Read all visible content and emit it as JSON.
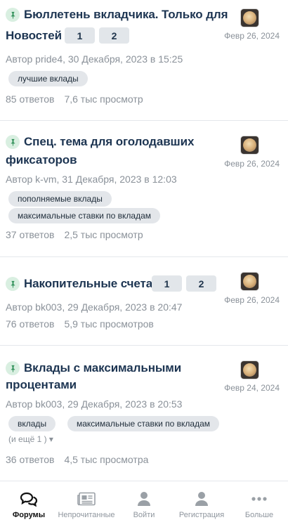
{
  "topics": [
    {
      "title_line1": "Бюллетень вкладчика. Только для",
      "title_line2": "Новостей",
      "pages": [
        "1",
        "2"
      ],
      "date": "Февр 26, 2024",
      "author_line": "Автор pride4, 30 Декабря, 2023 в 15:25",
      "tags": [
        "лучшие вклады"
      ],
      "replies": "85 ответов",
      "views": "7,6 тыс просмотр"
    },
    {
      "title_line1": "Спец. тема для оголодавших",
      "title_line2": "фиксаторов",
      "date": "Февр 26, 2024",
      "author_line": "Автор k-vm, 31 Декабря, 2023 в 12:03",
      "tags": [
        "пополняемые вклады",
        "максимальные ставки по вкладам"
      ],
      "replies": "37 ответов",
      "views": "2,5 тыс просмотр"
    },
    {
      "title_line1": "Накопительные счета",
      "pages": [
        "1",
        "2"
      ],
      "date": "Февр 26, 2024",
      "author_line": "Автор bk003, 29 Декабря, 2023 в 20:47",
      "replies": "76 ответов",
      "views": "5,9 тыс просмотров"
    },
    {
      "title_line1": "Вклады с максимальными",
      "title_line2": "процентами",
      "date": "Февр 24, 2024",
      "author_line": "Автор bk003, 29 Декабря, 2023 в 20:53",
      "tags": [
        "вклады",
        "максимальные ставки по вкладам"
      ],
      "more_tags": "(и ещё 1 ) ▾",
      "replies": "36 ответов",
      "views": "4,5 тыс просмотра"
    }
  ],
  "tabbar": [
    {
      "label": "Форумы",
      "icon": "forums-icon",
      "active": true
    },
    {
      "label": "Непрочитанные",
      "icon": "newspaper-icon",
      "active": false
    },
    {
      "label": "Войти",
      "icon": "user-icon",
      "active": false
    },
    {
      "label": "Регистрация",
      "icon": "user-plus-icon",
      "active": false
    },
    {
      "label": "Больше",
      "icon": "more-icon",
      "active": false
    }
  ],
  "colors": {
    "title": "#1d3552",
    "meta": "#8a9199",
    "pin_bg": "#d9efe1",
    "pin": "#2e8f57",
    "tag_bg": "#e3e6ea"
  }
}
